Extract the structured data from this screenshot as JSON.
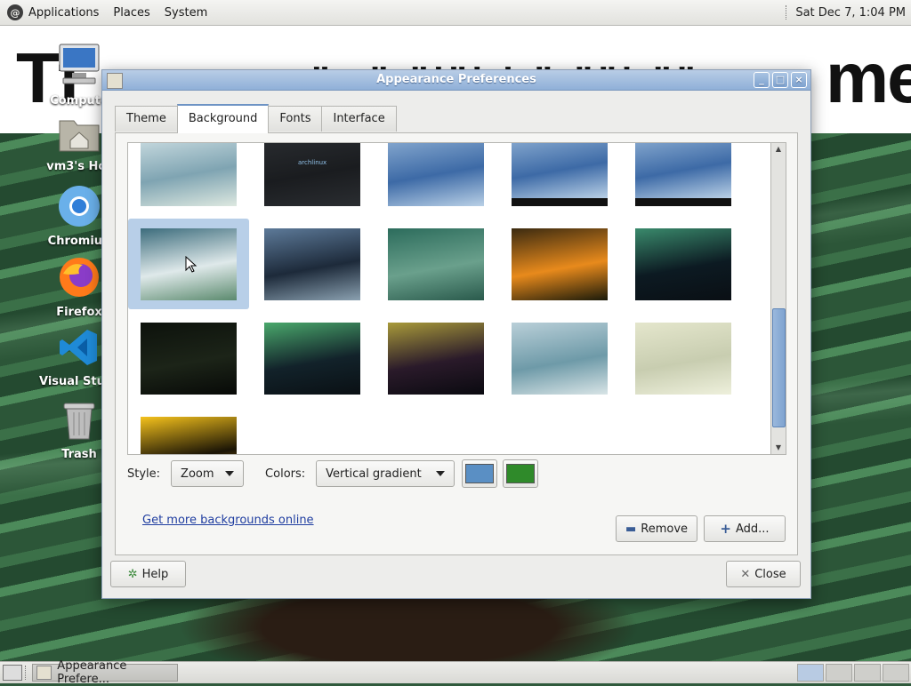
{
  "top_panel": {
    "menus": [
      "Applications",
      "Places",
      "System"
    ],
    "clock": "Sat Dec 7,  1:04 PM"
  },
  "banner": {
    "left_text": "Tf",
    "right_text": "me"
  },
  "desktop_icons": [
    {
      "label": "Compute",
      "icon": "computer-icon"
    },
    {
      "label": "vm3's Hor",
      "icon": "home-folder-icon"
    },
    {
      "label": "Chromiun",
      "icon": "chromium-icon"
    },
    {
      "label": "Firefox",
      "icon": "firefox-icon"
    },
    {
      "label": "Visual Studio",
      "icon": "vscode-icon"
    },
    {
      "label": "Trash",
      "icon": "trash-icon"
    }
  ],
  "dialog": {
    "title": "Appearance Preferences",
    "tabs": [
      "Theme",
      "Background",
      "Fonts",
      "Interface"
    ],
    "active_tab": "Background",
    "style_label": "Style:",
    "style_value": "Zoom",
    "colors_label": "Colors:",
    "colors_value": "Vertical gradient",
    "primary_color": "#5a8fc4",
    "secondary_color": "#2f8a2a",
    "link": "Get more backgrounds online",
    "remove_label": "Remove",
    "add_label": "Add...",
    "help_label": "Help",
    "close_label": "Close",
    "thumbnails": [
      {
        "name": "blue-waves",
        "colors": [
          "#cfe0e4",
          "#7fa4b2",
          "#dde8e0"
        ]
      },
      {
        "name": "arch-dark",
        "colors": [
          "#2a2d31",
          "#1a1c1f",
          "#2a2d31"
        ],
        "text": "archlinux"
      },
      {
        "name": "crystal-blue",
        "colors": [
          "#8fb0d4",
          "#3d6aa6",
          "#b9d0e6"
        ]
      },
      {
        "name": "crystal-blue-2",
        "colors": [
          "#8fb0d4",
          "#3d6aa6",
          "#b9d0e6"
        ]
      },
      {
        "name": "crystal-blue-3",
        "colors": [
          "#8fb0d4",
          "#3d6aa6",
          "#b9d0e6"
        ]
      },
      {
        "name": "green-sky",
        "colors": [
          "#3c6c7c",
          "#dfe9ea",
          "#5b8a6e"
        ]
      },
      {
        "name": "storm-road",
        "colors": [
          "#5d7a99",
          "#1d2a3a",
          "#8aa0b0"
        ]
      },
      {
        "name": "green-stripes",
        "colors": [
          "#2c6c5c",
          "#6aa08c",
          "#2a5a4c"
        ]
      },
      {
        "name": "orange-flower",
        "colors": [
          "#3b2a10",
          "#e88a1c",
          "#1a1a0a"
        ]
      },
      {
        "name": "aurora-1",
        "colors": [
          "#3a8a6c",
          "#0c1a22",
          "#0a0f14"
        ]
      },
      {
        "name": "dark-night",
        "colors": [
          "#0d120c",
          "#1c2418",
          "#070907"
        ]
      },
      {
        "name": "aurora-2",
        "colors": [
          "#4aa86c",
          "#12222a",
          "#0a1014"
        ]
      },
      {
        "name": "aurora-3",
        "colors": [
          "#a89a3a",
          "#2a1a2a",
          "#0a0a10"
        ]
      },
      {
        "name": "silver-curve",
        "colors": [
          "#b9cfd8",
          "#6e9aa8",
          "#d8e4e6"
        ]
      },
      {
        "name": "beige-sand",
        "colors": [
          "#e4e6cc",
          "#c8cdb0",
          "#eef0dc"
        ]
      },
      {
        "name": "yellow-flower",
        "colors": [
          "#f5c21c",
          "#1a1406",
          "#e8a010"
        ]
      }
    ]
  },
  "taskbar": {
    "window_button": "Appearance Prefere..."
  }
}
